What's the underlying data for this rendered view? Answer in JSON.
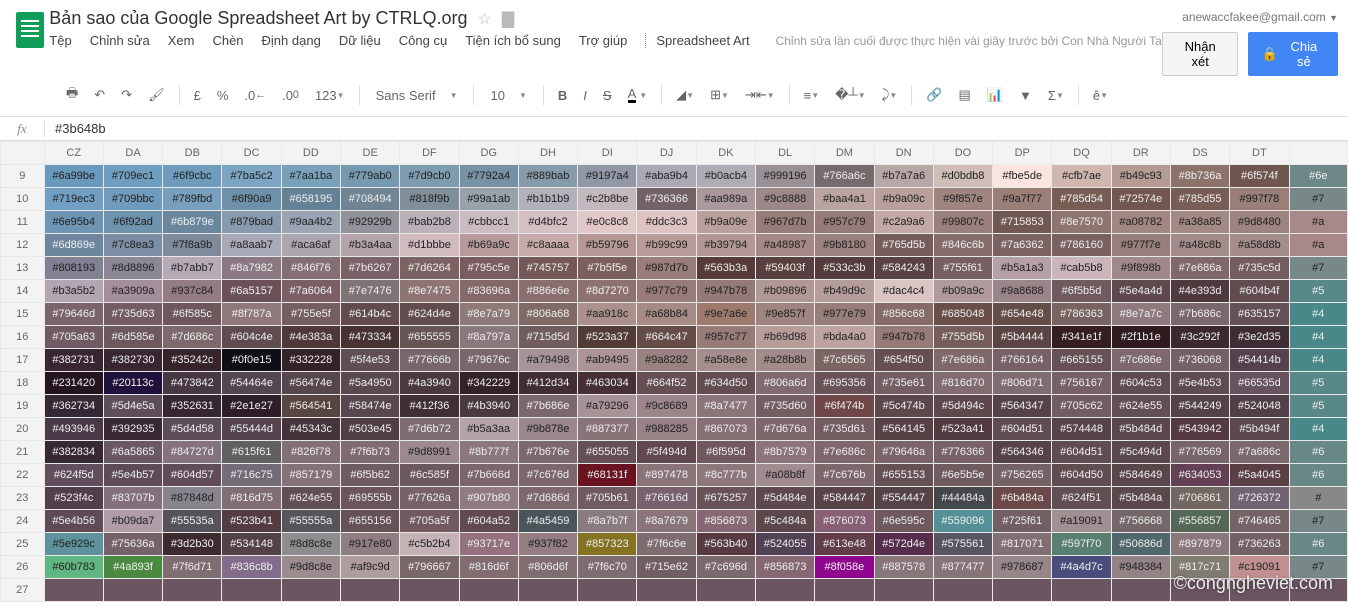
{
  "header": {
    "title": "Bản sao của Google Spreadsheet Art by CTRLQ.org",
    "account": "anewaccfakee@gmail.com",
    "comment_btn": "Nhận xét",
    "share_btn": "Chia sẻ"
  },
  "menu": [
    "Tệp",
    "Chỉnh sửa",
    "Xem",
    "Chèn",
    "Định dạng",
    "Dữ liệu",
    "Công cụ",
    "Tiện ích bổ sung",
    "Trợ giúp",
    "Spreadsheet Art"
  ],
  "edit_info": "Chỉnh sửa lần cuối được thực hiện vài giây trước bởi Con Nhà Người Ta",
  "toolbar": {
    "currency": "£",
    "percent": "%",
    "dec_dec": ".0",
    "dec_inc": ".00",
    "num_fmt": "123",
    "font": "Sans Serif",
    "size": "10",
    "bold": "B",
    "italic": "I",
    "strike": "S",
    "color": "A",
    "more": "ê"
  },
  "formula": {
    "fx": "fx",
    "value": "#3b648b"
  },
  "columns": [
    "CZ",
    "DA",
    "DB",
    "DC",
    "DD",
    "DE",
    "DF",
    "DG",
    "DH",
    "DI",
    "DJ",
    "DK",
    "DL",
    "DM",
    "DN",
    "DO",
    "DP",
    "DQ",
    "DR",
    "DS",
    "DT",
    ""
  ],
  "rows": [
    {
      "n": 9,
      "c": [
        "#6a99be",
        "#709ec1",
        "#6f9cbc",
        "#7ba5c2",
        "#7aa1ba",
        "#779ab0",
        "#7d9cb0",
        "#7792a4",
        "#889bab",
        "#9197a4",
        "#aba9b4",
        "#b0acb4",
        "#999196",
        "#766a6c",
        "#b7a7a6",
        "#d0bdb8",
        "#fbe5de",
        "#cfb7ae",
        "#b49c93",
        "#8b736a",
        "#6f574f",
        "#6e"
      ]
    },
    {
      "n": 10,
      "c": [
        "#719ec3",
        "#709bbc",
        "#789fbd",
        "#6f90a9",
        "#658195",
        "#708494",
        "#818f9b",
        "#99a1ab",
        "#b1b1b9",
        "#c2b8be",
        "#736366",
        "#aa989a",
        "#9c8888",
        "#baa4a1",
        "#b9a09c",
        "#9f857e",
        "#9a7f77",
        "#785d54",
        "#72574e",
        "#785d55",
        "#997f78",
        "#7"
      ]
    },
    {
      "n": 11,
      "c": [
        "#6e95b4",
        "#6f92ad",
        "#6b879e",
        "#879bad",
        "#9aa4b2",
        "#92929b",
        "#bab2b8",
        "#cbbcc1",
        "#d4bfc2",
        "#e0c8c8",
        "#ddc3c3",
        "#b9a09e",
        "#967d7b",
        "#957c79",
        "#c2a9a6",
        "#99807c",
        "#715853",
        "#8e7570",
        "#a08782",
        "#a38a85",
        "#9d8480",
        "#a"
      ]
    },
    {
      "n": 12,
      "c": [
        "#6d869e",
        "#7c8ea3",
        "#7f8a9b",
        "#a8aab7",
        "#aca6af",
        "#b3a4aa",
        "#d1bbbe",
        "#b69a9c",
        "#c8aaaa",
        "#b59796",
        "#b99c99",
        "#b39794",
        "#a48987",
        "#9b8180",
        "#765d5b",
        "#846c6b",
        "#7a6362",
        "#786160",
        "#977f7e",
        "#a48c8b",
        "#a58d8b",
        "#a"
      ]
    },
    {
      "n": 13,
      "c": [
        "#808193",
        "#8d8896",
        "#b7abb7",
        "#8a7982",
        "#846f76",
        "#7b6267",
        "#7d6264",
        "#795c5e",
        "#745757",
        "#7b5f5e",
        "#987d7b",
        "#563b3a",
        "#59403f",
        "#533c3b",
        "#584243",
        "#755f61",
        "#b5a1a3",
        "#cab5b8",
        "#9f898b",
        "#7e686a",
        "#735c5d",
        "#7"
      ]
    },
    {
      "n": 14,
      "c": [
        "#b3a5b2",
        "#a3909a",
        "#937c84",
        "#6a5157",
        "#7a6064",
        "#7e7476",
        "#8e7475",
        "#83696a",
        "#886e6e",
        "#8d7270",
        "#977c79",
        "#947b78",
        "#b09896",
        "#b49d9c",
        "#dac4c4",
        "#b09a9c",
        "#9a8688",
        "#6f5b5d",
        "#5e4a4d",
        "#4e393d",
        "#604b4f",
        "#5"
      ]
    },
    {
      "n": 15,
      "c": [
        "#79646d",
        "#735d63",
        "#6f585c",
        "#8f787a",
        "#755e5f",
        "#614b4c",
        "#624d4e",
        "#8e7a79",
        "#806a68",
        "#aa918c",
        "#a68b84",
        "#9e7a6e",
        "#9e857f",
        "#977e79",
        "#856c68",
        "#685048",
        "#654e48",
        "#786363",
        "#8e7a7c",
        "#7b686c",
        "#635157",
        "#4"
      ]
    },
    {
      "n": 16,
      "c": [
        "#705a63",
        "#6d585e",
        "#7d686c",
        "#604c4e",
        "#4e383a",
        "#473334",
        "#655555",
        "#8a797a",
        "#715d5d",
        "#523a37",
        "#664c47",
        "#957c77",
        "#b69d98",
        "#bda4a0",
        "#947b78",
        "#755d5b",
        "#5b4444",
        "#341e1f",
        "#2f1b1e",
        "#3c292f",
        "#3e2d35",
        "#4"
      ]
    },
    {
      "n": 17,
      "c": [
        "#382731",
        "#382730",
        "#35242c",
        "#0f0e15",
        "#332228",
        "#5f4e53",
        "#77666b",
        "#79676c",
        "#a79498",
        "#ab9495",
        "#9a8282",
        "#a58e8e",
        "#a28b8b",
        "#7c6565",
        "#654f50",
        "#7e686a",
        "#766164",
        "#665155",
        "#7c686e",
        "#736068",
        "#54414b",
        "#4"
      ]
    },
    {
      "n": 18,
      "c": [
        "#231420",
        "#20113c",
        "#473842",
        "#54464e",
        "#56474e",
        "#5a4950",
        "#4a3940",
        "#342229",
        "#412d34",
        "#463034",
        "#664f52",
        "#634d50",
        "#806a6d",
        "#695356",
        "#735e61",
        "#816d70",
        "#806d71",
        "#756167",
        "#604c53",
        "#5e4b53",
        "#66535d",
        "#5"
      ]
    },
    {
      "n": 19,
      "c": [
        "#362734",
        "#5d4e5a",
        "#352631",
        "#2e1e27",
        "#564541",
        "#58474e",
        "#412f36",
        "#4b3940",
        "#7b686e",
        "#a79296",
        "#9c8689",
        "#8a7477",
        "#735d60",
        "#6f474b",
        "#5c474b",
        "#5d494c",
        "#564347",
        "#705c62",
        "#624e55",
        "#544249",
        "#524048",
        "#5"
      ]
    },
    {
      "n": 20,
      "c": [
        "#493946",
        "#392935",
        "#5d4d58",
        "#55444d",
        "#45343c",
        "#503e45",
        "#7d6b72",
        "#b5a3aa",
        "#9b878e",
        "#887377",
        "#988285",
        "#867073",
        "#7d676a",
        "#735d61",
        "#564145",
        "#523a41",
        "#604d51",
        "#574448",
        "#5b484d",
        "#543942",
        "#5b494f",
        "#4"
      ]
    },
    {
      "n": 21,
      "c": [
        "#382834",
        "#6a5865",
        "#84727d",
        "#615f61",
        "#826f78",
        "#7f6b73",
        "#9d8991",
        "#8b777f",
        "#7b676e",
        "#655055",
        "#5f494d",
        "#6f595d",
        "#8b7579",
        "#7e686c",
        "#79646a",
        "#776366",
        "#564346",
        "#604d51",
        "#5c494d",
        "#776569",
        "#7a686c",
        "#6"
      ]
    },
    {
      "n": 22,
      "c": [
        "#624f5d",
        "#5e4b57",
        "#604d57",
        "#716c75",
        "#857179",
        "#6f5b62",
        "#6c585f",
        "#7b666d",
        "#7c676d",
        "#68131f",
        "#897478",
        "#8c777b",
        "#a08b8f",
        "#7c676b",
        "#655153",
        "#6e5b5e",
        "#756265",
        "#604d50",
        "#584649",
        "#634053",
        "#5a4045",
        "#6"
      ]
    },
    {
      "n": 23,
      "c": [
        "#523f4c",
        "#83707b",
        "#87848d",
        "#816d75",
        "#624e55",
        "#69555b",
        "#77626a",
        "#907b80",
        "#7d686d",
        "#705b61",
        "#76616d",
        "#675257",
        "#5d484e",
        "#584447",
        "#554447",
        "#44484a",
        "#6b484a",
        "#624f51",
        "#5b484a",
        "#706861",
        "#726372",
        "#"
      ]
    },
    {
      "n": 24,
      "c": [
        "#5e4b56",
        "#b09da7",
        "#55535a",
        "#523b41",
        "#55555a",
        "#655156",
        "#705a5f",
        "#604a52",
        "#4a5459",
        "#8a7b7f",
        "#8a7679",
        "#856873",
        "#5c484a",
        "#876073",
        "#6e595c",
        "#559096",
        "#725f61",
        "#a19091",
        "#756668",
        "#556857",
        "#746465",
        "#7"
      ]
    },
    {
      "n": 25,
      "c": [
        "#5e929c",
        "#75636a",
        "#3d2b30",
        "#534148",
        "#8d8c8e",
        "#917e80",
        "#c5b2b4",
        "#93717e",
        "#937f82",
        "#857323",
        "#7f6c6e",
        "#563b40",
        "#524055",
        "#613e48",
        "#572d4e",
        "#575561",
        "#817071",
        "#597f70",
        "#50686d",
        "#897879",
        "#736263",
        "#6"
      ]
    },
    {
      "n": 26,
      "c": [
        "#60b783",
        "#4a893f",
        "#7f6d71",
        "#836c8b",
        "#9d8c8e",
        "#af9c9d",
        "#796667",
        "#816d6f",
        "#806d6f",
        "#7f6c70",
        "#715e62",
        "#7c696d",
        "#856873",
        "#8f058e",
        "#887578",
        "#877477",
        "#978687",
        "#4a4d7c",
        "#948384",
        "#817c71",
        "#c19091",
        "#7"
      ]
    }
  ],
  "watermark": "©congngheviet.com"
}
